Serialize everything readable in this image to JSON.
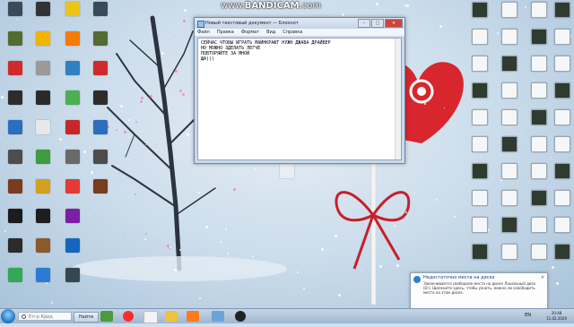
{
  "watermark": {
    "prefix": "www.",
    "brand": "BANDICAM",
    "suffix": ".com"
  },
  "notepad": {
    "title": "Новый текстовый документ — Блокнот",
    "menu": [
      "Файл",
      "Правка",
      "Формат",
      "Вид",
      "Справка"
    ],
    "content": "СЕЙЧАС ЧТОБЫ ИГРАТЬ МАЙНКРАФТ НУЖН ДЖАВА ДРАЙВЕР\nНО МОЖНО ЗДЕЛАТЬ ЛЕГЧЕ\nПОВТОРЯЙТЕ ЗА МНОЙ\nЩА)))"
  },
  "taskbar": {
    "search_placeholder": "Етгр Крид",
    "find_label": "Найти",
    "language": "EN",
    "time": "20:48",
    "date": "11.02.2020"
  },
  "toast": {
    "title": "Недостаточно места на диске",
    "body": "Заканчивается свободное место на диске Локальный диск (D:). Щелкните здесь, чтобы узнать, можно ли освободить место на этом диске.",
    "close": "×"
  },
  "colors": {
    "accent": "#1b6fbf",
    "heart": "#d8262f",
    "ribbon": "#c71f2a"
  }
}
